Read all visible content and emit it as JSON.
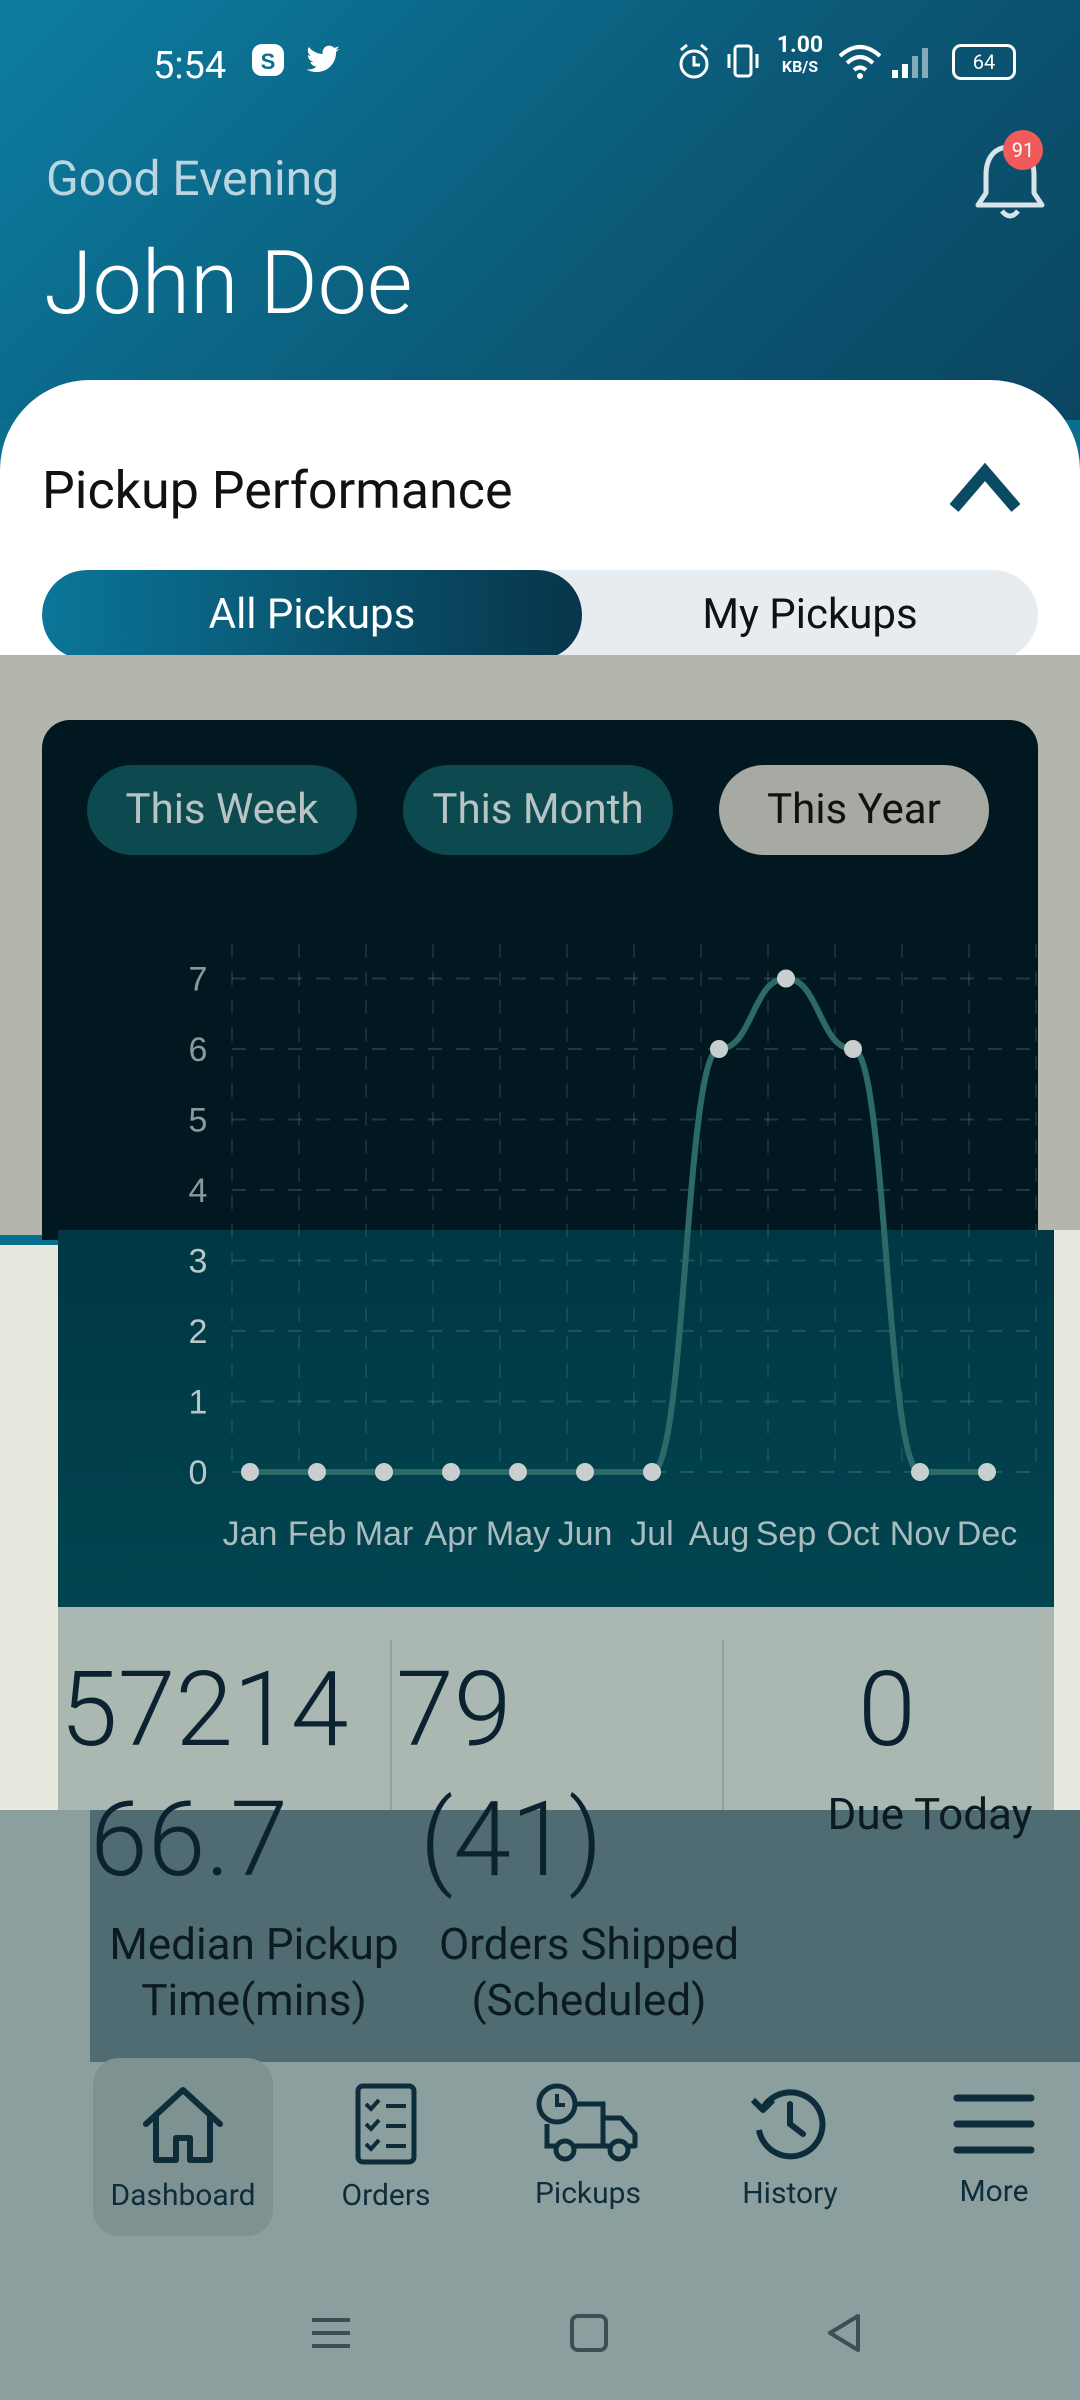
{
  "status_bar": {
    "time": "5:54",
    "data_speed_value": "1.00",
    "data_speed_unit": "KB/S",
    "battery": "64"
  },
  "header": {
    "greeting": "Good Evening",
    "user_name": "John Doe",
    "notification_count": "91"
  },
  "performance_card": {
    "title": "Pickup Performance",
    "segment_tabs": [
      "All Pickups",
      "My Pickups"
    ],
    "active_segment": "All Pickups",
    "period_chips": [
      "This Week",
      "This Month",
      "This Year"
    ],
    "active_period": "This Year"
  },
  "chart_data": {
    "type": "line",
    "categories": [
      "Jan",
      "Feb",
      "Mar",
      "Apr",
      "May",
      "Jun",
      "Jul",
      "Aug",
      "Sep",
      "Oct",
      "Nov",
      "Dec"
    ],
    "values": [
      0,
      0,
      0,
      0,
      0,
      0,
      0,
      6,
      7,
      6,
      0,
      0
    ],
    "yticks": [
      "0",
      "1",
      "2",
      "3",
      "4",
      "5",
      "6",
      "7"
    ],
    "ylim": [
      0,
      7
    ],
    "grid": true
  },
  "stats": {
    "row1": [
      "57214",
      "79",
      "0"
    ],
    "row1_label_right": "Due Today",
    "row2_value_left": "66.7",
    "row2_value_right": "(41)",
    "label_left_line1": "Median Pickup",
    "label_left_line2": "Time(mins)",
    "label_right_line1": "Orders Shipped",
    "label_right_line2": "(Scheduled)"
  },
  "bottom_nav": {
    "items": [
      "Dashboard",
      "Orders",
      "Pickups",
      "History",
      "More"
    ],
    "active": "Dashboard"
  },
  "colors": {
    "header_start": "#0c7da1",
    "header_end": "#0a4560",
    "chart_bg": "#021820",
    "badge": "#f05a5a"
  }
}
